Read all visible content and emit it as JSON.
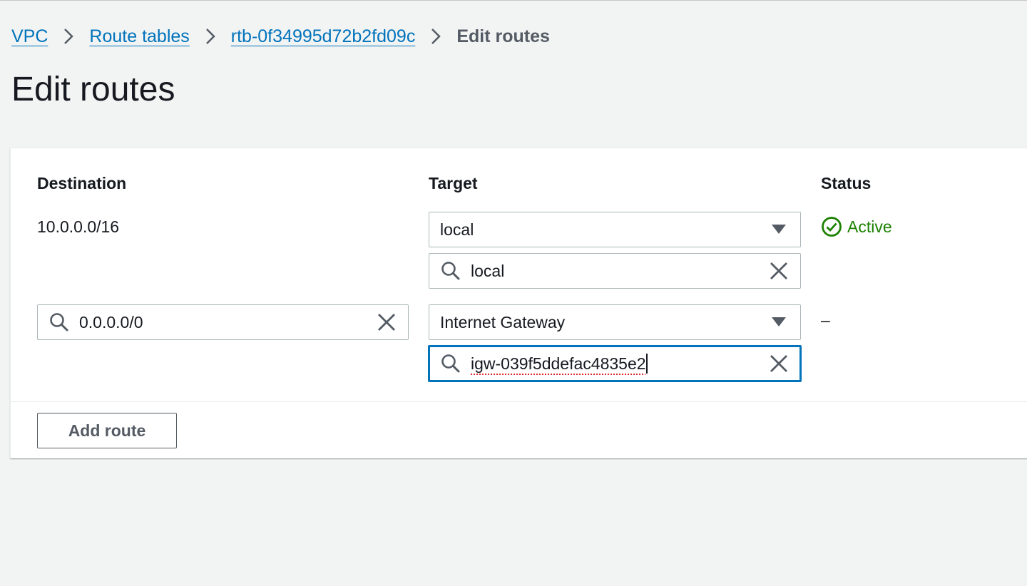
{
  "breadcrumb": {
    "items": [
      {
        "label": "VPC"
      },
      {
        "label": "Route tables"
      },
      {
        "label": "rtb-0f34995d72b2fd09c"
      }
    ],
    "current": "Edit routes"
  },
  "page": {
    "title": "Edit routes"
  },
  "table": {
    "headers": {
      "destination": "Destination",
      "target": "Target",
      "status": "Status"
    },
    "routes": [
      {
        "destination": "10.0.0.0/16",
        "target_type": "local",
        "target_value": "local",
        "status": "Active"
      },
      {
        "destination": "0.0.0.0/0",
        "target_type": "Internet Gateway",
        "target_value": "igw-039f5ddefac4835e2",
        "status": "–"
      }
    ]
  },
  "actions": {
    "add_route": "Add route"
  },
  "colors": {
    "link": "#0073bb",
    "active": "#1d8102",
    "focus": "#0073bb"
  }
}
